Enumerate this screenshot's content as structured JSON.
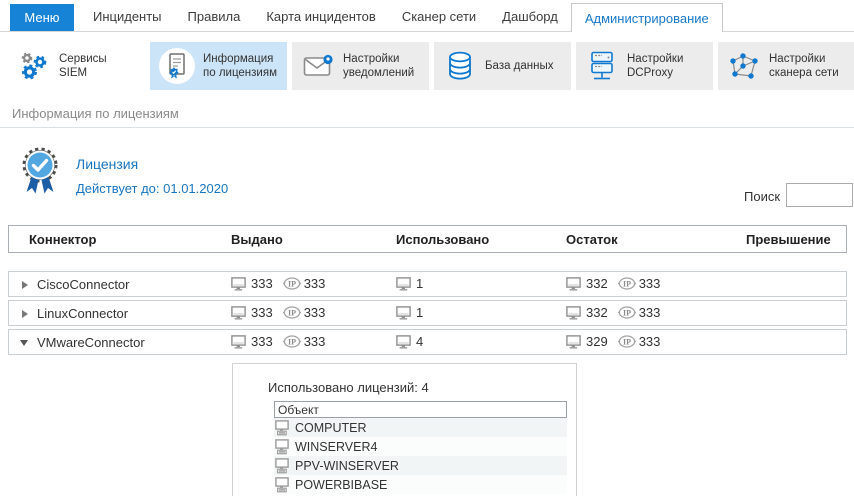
{
  "topnav": {
    "menu_label": "Меню",
    "tabs": [
      "Инциденты",
      "Правила",
      "Карта инцидентов",
      "Сканер сети",
      "Дашборд",
      "Администрирование"
    ],
    "active_tab": "Администрирование"
  },
  "toolbar": {
    "buttons": [
      {
        "line1": "Сервисы",
        "line2": "SIEM",
        "icon": "gears-icon",
        "state": "normal"
      },
      {
        "line1": "Информация",
        "line2": "по лицензиям",
        "icon": "license-certificate-icon",
        "state": "selected"
      },
      {
        "line1": "Настройки",
        "line2": "уведомлений",
        "icon": "mail-notification-icon",
        "state": "normal"
      },
      {
        "line1": "База данных",
        "line2": "",
        "icon": "database-icon",
        "state": "normal"
      },
      {
        "line1": "Настройки",
        "line2": "DCProxy",
        "icon": "proxy-server-icon",
        "state": "normal"
      },
      {
        "line1": "Настройки",
        "line2": "сканера сети",
        "icon": "network-scanner-icon",
        "state": "normal"
      }
    ]
  },
  "section": {
    "title": "Информация по лицензиям"
  },
  "license": {
    "title": "Лицензия",
    "valid_until": "Действует до: 01.01.2020",
    "badge_icon": "rosette-check-icon"
  },
  "search": {
    "label": "Поиск",
    "value": ""
  },
  "table": {
    "columns": [
      "Коннектор",
      "Выдано",
      "Использовано",
      "Остаток",
      "Превышение"
    ],
    "rows": [
      {
        "name": "CiscoConnector",
        "expanded": false,
        "issued_pc": "333",
        "issued_ip": "333",
        "used_pc": "1",
        "remain_pc": "332",
        "remain_ip": "333",
        "excess": ""
      },
      {
        "name": "LinuxConnector",
        "expanded": false,
        "issued_pc": "333",
        "issued_ip": "333",
        "used_pc": "1",
        "remain_pc": "332",
        "remain_ip": "333",
        "excess": ""
      },
      {
        "name": "VMwareConnector",
        "expanded": true,
        "issued_pc": "333",
        "issued_ip": "333",
        "used_pc": "4",
        "remain_pc": "329",
        "remain_ip": "333",
        "excess": ""
      }
    ]
  },
  "detail": {
    "used_label": "Использовано лицензий:",
    "used_count": "4",
    "object_column": "Объект",
    "objects": [
      "COMPUTER",
      "WINSERVER4",
      "PPV-WINSERVER",
      "POWERBIBASE"
    ]
  },
  "colors": {
    "accent_blue": "#1683d7",
    "selected_toolbar_bg": "#cce4f7",
    "toolbar_btn_bg": "#ececec",
    "link_blue": "#1a75c0",
    "badge_blue": "#52a7e0",
    "ribbon_blue": "#1b5ea6"
  }
}
